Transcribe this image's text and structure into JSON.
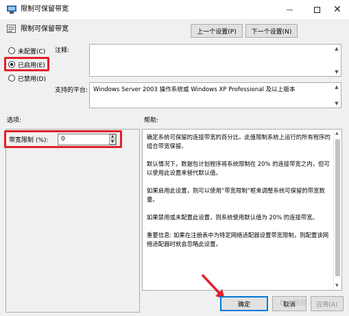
{
  "window": {
    "title": "限制可保留带宽",
    "controls": {
      "minimize": "—",
      "maximize": "□",
      "close": "✕"
    }
  },
  "header": {
    "setting_name": "限制可保留带宽",
    "prev_button": "上一个设置(P)",
    "next_button": "下一个设置(N)"
  },
  "state": {
    "options": [
      {
        "label": "未配置(C)",
        "checked": false
      },
      {
        "label": "已启用(E)",
        "checked": true
      },
      {
        "label": "已禁用(D)",
        "checked": false
      }
    ]
  },
  "comment": {
    "label": "注释:",
    "value": ""
  },
  "platform": {
    "label": "支持的平台:",
    "value": "Windows Server 2003 操作系统或 Windows XP Professional 及以上版本"
  },
  "options_section": {
    "label": "选项:",
    "bandwidth_label": "带宽限制 (%):",
    "bandwidth_value": "0"
  },
  "help_section": {
    "label": "帮助:",
    "paragraphs": [
      "确定系统可保留的连接带宽的百分比。此值限制系统上运行的所有程序的组合带宽保留。",
      "默认情况下，数据包计划程序将系统限制在 20% 的连接带宽之内，但可以使用此设置来替代默认值。",
      "如果启用此设置，则可以使用“带宽限制”框来调整系统可保留的带宽数量。",
      "如果禁用或未配置此设置，则系统使用默认值为 20% 的连接带宽。",
      "重要信息: 如果在注册表中为特定网络适配器设置带宽限制，则配置该网络适配器时就会忽略此设置。"
    ]
  },
  "footer": {
    "ok": "确定",
    "cancel": "取消",
    "apply": "应用(A)"
  },
  "watermark": "Bai 经验",
  "colors": {
    "highlight_red": "#e0202a",
    "accent_blue": "#0078d7"
  }
}
